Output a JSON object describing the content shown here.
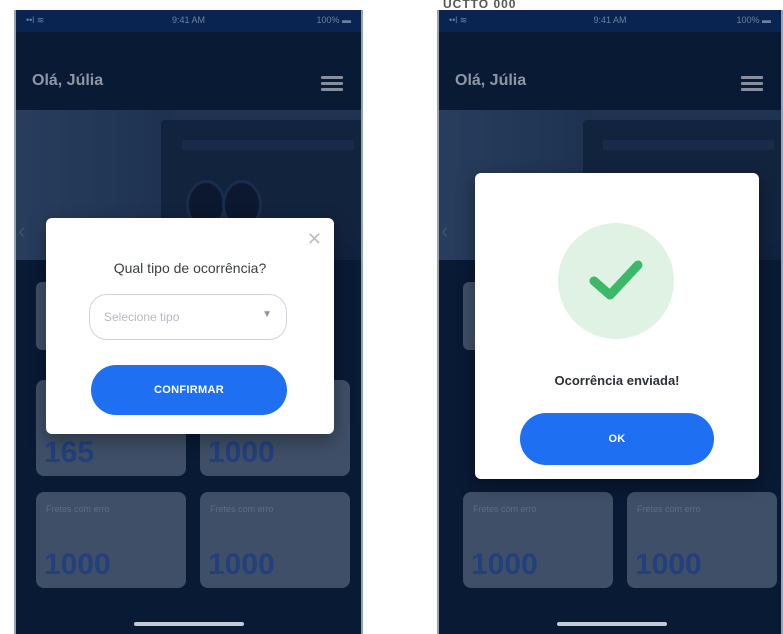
{
  "left_screen": {
    "status": {
      "signal": "••l ≋",
      "time": "9:41 AM",
      "battery": "100% ▬"
    },
    "greeting": "Olá, Júlia",
    "cards": [
      {
        "label": "",
        "value": "165"
      },
      {
        "label": "",
        "value": "1000"
      },
      {
        "label": "Fretes com erro",
        "value": "1000"
      },
      {
        "label": "Fretes com erro",
        "value": "1000"
      }
    ],
    "modal": {
      "title": "Qual tipo de ocorrência?",
      "select_placeholder": "Selecione tipo",
      "confirm_label": "CONFIRMAR"
    }
  },
  "right_screen": {
    "top_text": "UCTTO 000",
    "status": {
      "signal": "••l ≋",
      "time": "9:41 AM",
      "battery": "100% ▬"
    },
    "greeting": "Olá, Júlia",
    "cards": [
      {
        "label": "Fretes com erro",
        "value": "1000"
      },
      {
        "label": "Fretes com erro",
        "value": "1000"
      }
    ],
    "modal": {
      "message": "Ocorrência enviada!",
      "ok_label": "OK"
    }
  },
  "colors": {
    "primary": "#1e6ff2",
    "background": "#0a1d3a",
    "success": "#3cb86a"
  }
}
